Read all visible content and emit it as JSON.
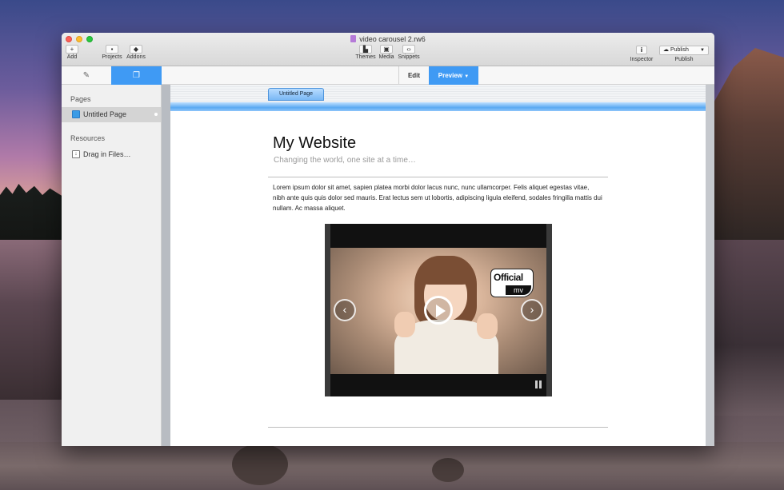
{
  "window": {
    "title": "video carousel 2.rw6"
  },
  "toolbar": {
    "add_label": "Add",
    "projects_label": "Projects",
    "addons_label": "Addons",
    "themes_label": "Themes",
    "media_label": "Media",
    "snippets_label": "Snippets",
    "inspector_label": "Inspector",
    "publish_button": "Publish",
    "publish_label": "Publish"
  },
  "modes": {
    "edit_label": "Edit",
    "preview_label": "Preview"
  },
  "sidebar": {
    "pages_heading": "Pages",
    "pages": [
      {
        "label": "Untitled Page"
      }
    ],
    "resources_heading": "Resources",
    "resources": [
      {
        "label": "Drag in Files…"
      }
    ]
  },
  "page_tab": {
    "label": "Untitled Page"
  },
  "site": {
    "title": "My Website",
    "slogan": "Changing the world, one site at a time…",
    "body": "Lorem ipsum dolor sit amet, sapien platea morbi dolor lacus nunc, nunc ullamcorper. Felis aliquet egestas vitae, nibh ante quis quis dolor sed mauris. Erat lectus sem ut lobortis, adipiscing ligula eleifend, sodales fringilla mattis dui nullam. Ac massa aliquet."
  },
  "video": {
    "badge_top": "Official",
    "badge_bottom": "mv"
  },
  "colors": {
    "accent": "#3f9af4",
    "close": "#fc5f57",
    "minimize": "#fdbc2e",
    "maximize": "#28c840"
  }
}
